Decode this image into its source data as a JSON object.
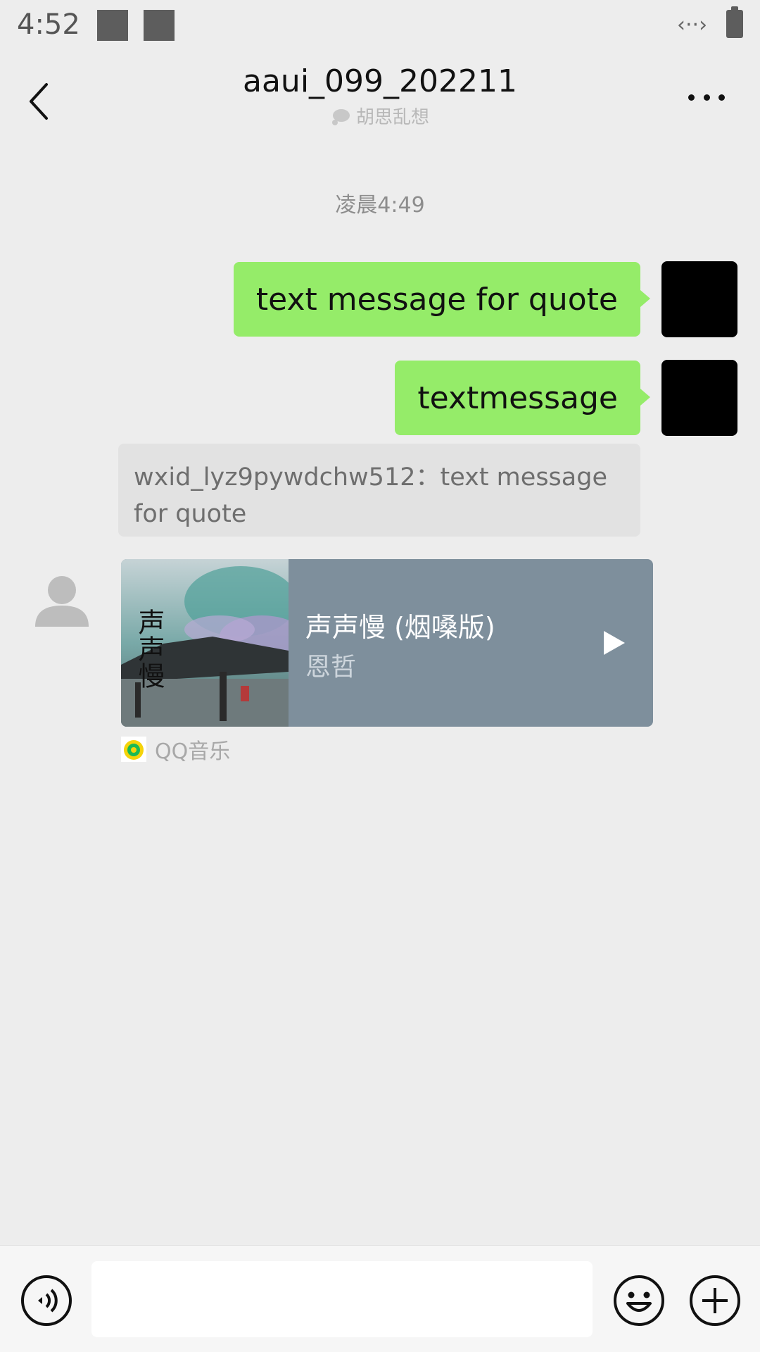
{
  "status_bar": {
    "time": "4:52",
    "connection_glyph": "‹··›"
  },
  "header": {
    "title": "aaui_099_202211",
    "status_text": "胡思乱想"
  },
  "chat": {
    "timestamp": "凌晨4:49",
    "messages": [
      {
        "direction": "out",
        "text": "text message for quote"
      },
      {
        "direction": "out",
        "text": "textmessage"
      }
    ],
    "quote": {
      "text": "wxid_lyz9pywdchw512：text message for quote"
    },
    "music_card": {
      "song_title": "声声慢 (烟嗓版)",
      "artist": "恩哲",
      "source": "QQ音乐",
      "album_art_text": "声声慢"
    }
  },
  "input_bar": {
    "placeholder": ""
  },
  "colors": {
    "background": "#ededed",
    "outgoing_bubble": "#95ec69",
    "music_card": "#7e8f9c",
    "quote_background": "#e2e2e2"
  },
  "icons": [
    "back-arrow-icon",
    "more-icon",
    "status-bubble-icon",
    "play-icon",
    "qq-music-icon",
    "voice-icon",
    "emoji-icon",
    "plus-icon"
  ]
}
